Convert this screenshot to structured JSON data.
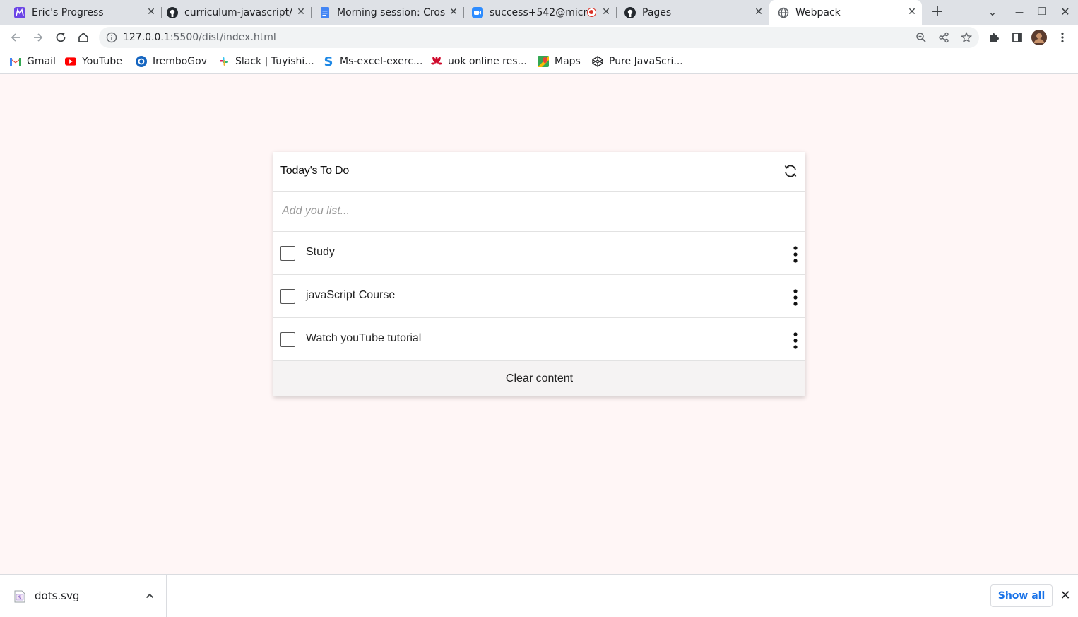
{
  "browser": {
    "tabs": [
      {
        "title": "Eric's Progress",
        "icon": "microverse-icon"
      },
      {
        "title": "curriculum-javascript/",
        "icon": "github-icon"
      },
      {
        "title": "Morning session: Cros",
        "icon": "google-docs-icon"
      },
      {
        "title": "success+542@micr",
        "icon": "zoom-icon"
      },
      {
        "title": "Pages",
        "icon": "github-icon"
      },
      {
        "title": "Webpack",
        "icon": "globe-icon"
      }
    ],
    "new_tab": "+",
    "tab_search": "⌄",
    "window_controls": {
      "minimize": "—",
      "restore": "❐",
      "close": "✕"
    },
    "tab_close": "✕",
    "url_host": "127.0.0.1",
    "url_rest": ":5500/dist/index.html"
  },
  "bookmarks": [
    {
      "label": "Gmail",
      "icon": "gmail-icon",
      "color": "#ea4335"
    },
    {
      "label": "YouTube",
      "icon": "youtube-icon",
      "color": "#ff0000"
    },
    {
      "label": "IremboGov",
      "icon": "irembo-icon",
      "color": "#1565c0"
    },
    {
      "label": "Slack | Tuyishi...",
      "icon": "slack-icon",
      "color": "#e01e5a"
    },
    {
      "label": "Ms-excel-exerc...",
      "icon": "s-icon",
      "color": "#1e88e5"
    },
    {
      "label": "uok online res...",
      "icon": "huawei-icon",
      "color": "#cf0a2c"
    },
    {
      "label": "Maps",
      "icon": "maps-icon",
      "color": "#34a853"
    },
    {
      "label": "Pure JavaScri...",
      "icon": "codepen-icon",
      "color": "#202124"
    }
  ],
  "todo": {
    "title": "Today's To Do",
    "input_placeholder": "Add you list...",
    "items": [
      {
        "label": "Study",
        "completed": false
      },
      {
        "label": "javaScript Course",
        "completed": false
      },
      {
        "label": "Watch youTube tutorial",
        "completed": false
      }
    ],
    "clear_label": "Clear content"
  },
  "downloads": {
    "file_name": "dots.svg",
    "show_all": "Show all",
    "close": "✕"
  },
  "colors": {
    "page_bg": "#fff6f6",
    "link_blue": "#1a73e8",
    "tabstrip_bg": "#dee1e6"
  }
}
